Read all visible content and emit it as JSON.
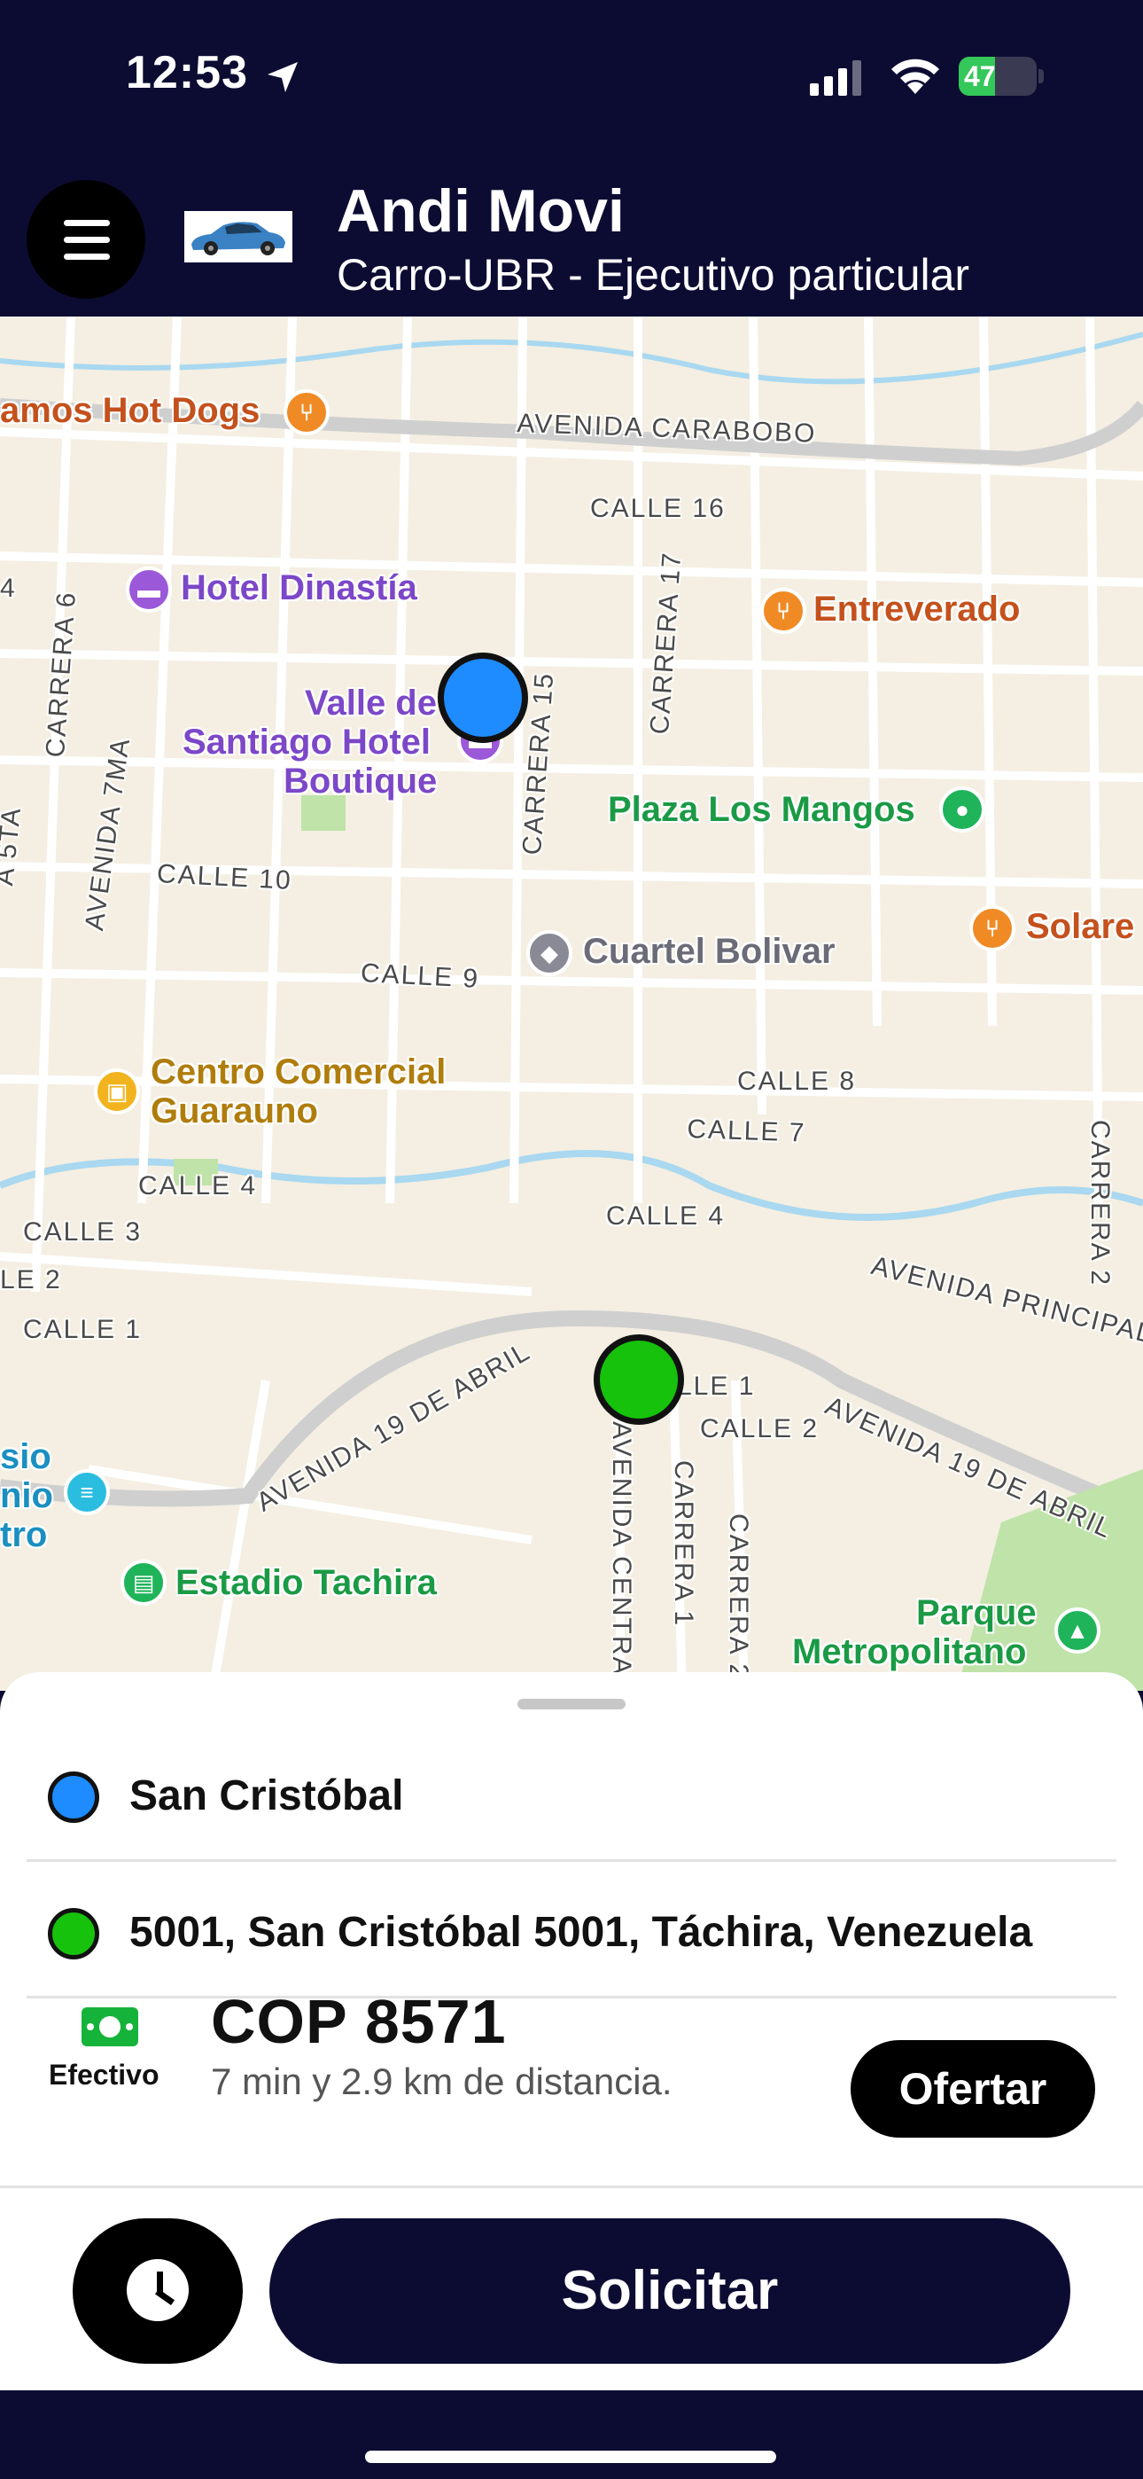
{
  "status_bar": {
    "time": "12:53",
    "battery_percent": 47,
    "battery_label": "47"
  },
  "header": {
    "driver_name": "Andi Movi",
    "vehicle": "Carro-UBR - Ejecutivo particular",
    "menu_icon": "hamburger-menu-icon"
  },
  "map": {
    "pois": {
      "hot_dogs": "amos Hot Dogs",
      "hotel_dinastia": "Hotel Dinastía",
      "valle_line1": "Valle de",
      "valle_line2": "Santiago Hotel",
      "valle_line3": "Boutique",
      "entreverado": "Entreverado",
      "plaza": "Plaza Los Mangos",
      "solare": "Solare",
      "cuartel": "Cuartel Bolivar",
      "centro_line1": "Centro Comercial",
      "centro_line2": "Guarauno",
      "sio_line1": "sio",
      "sio_line2": "nio",
      "sio_line3": "tro",
      "estadio": "Estadio Tachira",
      "parque_line1": "Parque",
      "parque_line2": "Metropolitano"
    },
    "streets": {
      "carabobo": "AVENIDA CARABOBO",
      "calle16": "CALLE 16",
      "carrera17": "CARRERA 17",
      "carrera15": "CARRERA 15",
      "carrera6": "CARRERA 6",
      "avenida7ma": "AVENIDA 7MA",
      "sta": "A 5TA",
      "calle10": "CALLE 10",
      "calle9": "CALLE 9",
      "calle8": "CALLE 8",
      "calle7": "CALLE 7",
      "calle4a": "CALLE 4",
      "calle4b": "CALLE 4",
      "calle3": "CALLE 3",
      "calle2a": "LE 2",
      "calle1a": "CALLE 1",
      "calle1b": "LLE 1",
      "calle2b": "CALLE 2",
      "abril_left": "AVENIDA 19 DE ABRIL",
      "abril_right": "AVENIDA 19 DE ABRIL",
      "principal": "AVENIDA PRINCIPAL",
      "carrera2a": "CARRERA 2",
      "central": "AVENIDA CENTRAL",
      "carrera1": "CARRERA 1",
      "carrera2b": "CARRERA 2",
      "four": "4"
    }
  },
  "trip": {
    "origin": "San Cristóbal",
    "destination": "5001, San Cristóbal 5001, Táchira, Venezuela",
    "payment_method": "Efectivo",
    "price": "COP 8571",
    "info": "7 min y 2.9 km de distancia.",
    "offer_label": "Ofertar",
    "request_label": "Solicitar"
  },
  "colors": {
    "navy": "#0c0c33",
    "origin_pin": "#1e8cff",
    "destination_pin": "#16c20c",
    "cash_green": "#16b33a"
  }
}
